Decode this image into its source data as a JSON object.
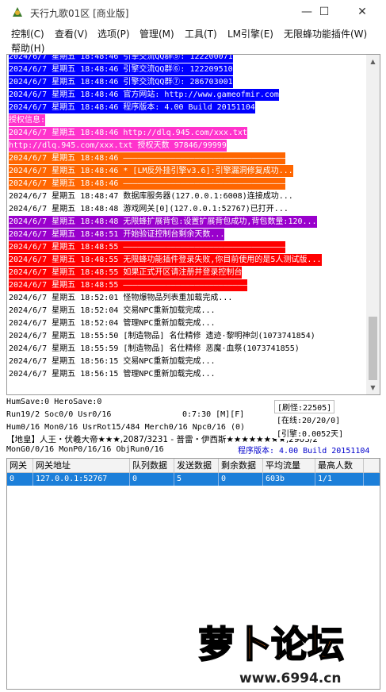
{
  "window": {
    "title": "天行九歌01区 [商业版]",
    "controls": {
      "minimize": "—",
      "maximize": "☐",
      "close": "✕"
    }
  },
  "menu": [
    "控制(C)",
    "查看(V)",
    "选项(P)",
    "管理(M)",
    "工具(T)",
    "LM引擎(E)",
    "无限蜂功能插件(W)",
    "帮助(H)"
  ],
  "log": [
    {
      "text": "2024/6/7 星期五 18:48:46 引擎交流QQ群⑤: 122200071",
      "fg": "#ffffff",
      "bg": "#0000ff"
    },
    {
      "text": "2024/6/7 星期五 18:48:46 引擎交流QQ群⑥: 122209510",
      "fg": "#ffffff",
      "bg": "#0000ff"
    },
    {
      "text": "2024/6/7 星期五 18:48:46 引擎交流QQ群⑦: 286703001",
      "fg": "#ffffff",
      "bg": "#0000ff"
    },
    {
      "text": "2024/6/7 星期五 18:48:46 官方网站: http://www.gameofmir.com",
      "fg": "#ffffff",
      "bg": "#0000ff"
    },
    {
      "text": "2024/6/7 星期五 18:48:46 程序版本: 4.00 Build 20151104",
      "fg": "#ffffff",
      "bg": "#0000ff"
    },
    {
      "text": "授权信息:",
      "fg": "#ffffff",
      "bg": "#ff33cc"
    },
    {
      "text": "2024/6/7 星期五 18:48:46 http://dlq.945.com/xxx.txt",
      "fg": "#ffffff",
      "bg": "#ff33cc"
    },
    {
      "text": "http://dlq.945.com/xxx.txt 授权天数 97846/99999",
      "fg": "#ffffff",
      "bg": "#ff33cc"
    },
    {
      "text": "2024/6/7 星期五 18:48:46 ——————————————————————————————————",
      "fg": "#ffffff",
      "bg": "#ff6600"
    },
    {
      "text": "2024/6/7 星期五 18:48:46 * [LM反外挂引擎v3.6]:引擎漏洞修复成功...",
      "fg": "#ffffff",
      "bg": "#ff6600"
    },
    {
      "text": "2024/6/7 星期五 18:48:46 ——————————————————————————————————",
      "fg": "#ffffff",
      "bg": "#ff6600"
    },
    {
      "text": "2024/6/7 星期五 18:48:47 数据库服务器(127.0.0.1:6008)连接成功...",
      "fg": "#000000",
      "bg": "transparent"
    },
    {
      "text": "2024/6/7 星期五 18:48:48 游戏网关[0](127.0.0.1:52767)已打开...",
      "fg": "#000000",
      "bg": "transparent"
    },
    {
      "text": "2024/6/7 星期五 18:48:48 无限蜂扩展背包:设置扩展背包成功,背包数量:120...",
      "fg": "#ffffff",
      "bg": "#9900cc"
    },
    {
      "text": "2024/6/7 星期五 18:48:51 开始验证控制台剩余天数...",
      "fg": "#ffffff",
      "bg": "#9900cc"
    },
    {
      "text": "2024/6/7 星期五 18:48:55 ——————————————————————————————————",
      "fg": "#ffffff",
      "bg": "#ff0000"
    },
    {
      "text": "2024/6/7 星期五 18:48:55 无限蜂功能插件登录失败,你目前使用的是5人测试版...",
      "fg": "#ffffff",
      "bg": "#ff0000"
    },
    {
      "text": "2024/6/7 星期五 18:48:55 如果正式开区请注册并登录控制台",
      "fg": "#ffffff",
      "bg": "#ff0000"
    },
    {
      "text": "2024/6/7 星期五 18:48:55 ——————————————————————————",
      "fg": "#ffffff",
      "bg": "#ff0000"
    },
    {
      "text": "2024/6/7 星期五 18:52:01 怪物爆物品列表重加载完成...",
      "fg": "#000000",
      "bg": "transparent"
    },
    {
      "text": "2024/6/7 星期五 18:52:04 交易NPC重新加载完成...",
      "fg": "#000000",
      "bg": "transparent"
    },
    {
      "text": "2024/6/7 星期五 18:52:04 管理NPC重新加载完成...",
      "fg": "#000000",
      "bg": "transparent"
    },
    {
      "text": "2024/6/7 星期五 18:55:50 [制造物品] 名仕精修 遗迹·黎明神剑(1073741854)",
      "fg": "#000000",
      "bg": "transparent"
    },
    {
      "text": "2024/6/7 星期五 18:55:59 [制造物品] 名仕精修 恶魔·血祭(1073741855)",
      "fg": "#000000",
      "bg": "transparent"
    },
    {
      "text": "2024/6/7 星期五 18:56:15 交易NPC重新加载完成...",
      "fg": "#000000",
      "bg": "transparent"
    },
    {
      "text": "2024/6/7 星期五 18:56:15 管理NPC重新加载完成...",
      "fg": "#000000",
      "bg": "transparent"
    }
  ],
  "status": {
    "save": "HumSave:0 HeroSave:0",
    "run": "Run19/2 Soc0/0 Usr0/16",
    "time": "0:7:30 [M][F]",
    "hum": "Hum0/16 Mon0/16 UsrRot15/484 Merch0/16 Npc0/16 (0)",
    "rank": "【地皇】人王・伏羲大帝★★★,2087/3231 - 普雷・伊西斯★★★★★★★★,2903/2",
    "mon": "MonG0/0/16 MonP0/16/16 ObjRun0/16",
    "brush": "[刷怪:22505]",
    "online": "[在线:20/20/0]",
    "engine": "[引擎:0.0052天]",
    "version": "程序版本: 4.00 Build 20151104"
  },
  "grid": {
    "headers": [
      "网关",
      "网关地址",
      "队列数据",
      "发送数据",
      "剩余数据",
      "平均流量",
      "最高人数"
    ],
    "rows": [
      [
        "0",
        "127.0.0.1:52767",
        "0",
        "5",
        "0",
        "603b",
        "1/1"
      ]
    ]
  },
  "watermark": {
    "logo_text": "萝卜论坛",
    "url": "www.6994.cn",
    "color": "#ff7a1a"
  }
}
